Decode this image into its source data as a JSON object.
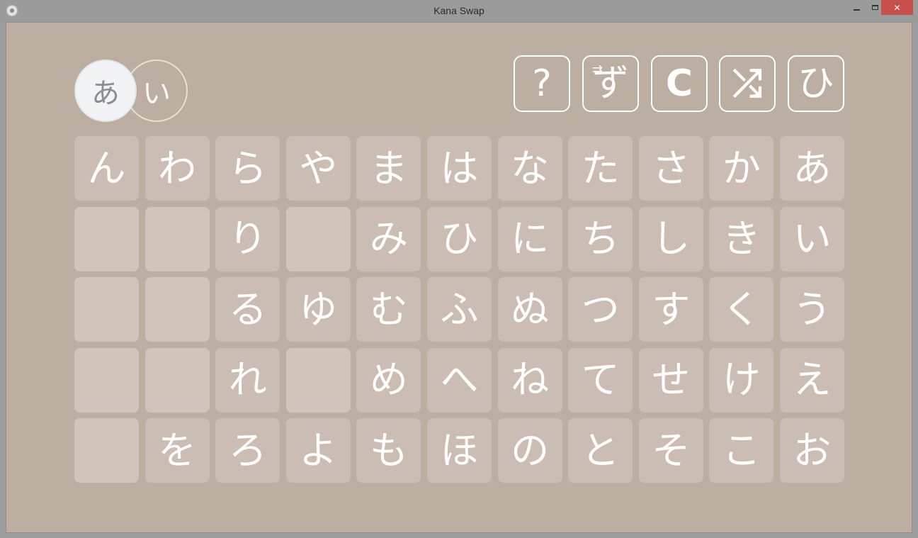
{
  "window": {
    "title": "Kana Swap",
    "close_label": "✕",
    "close_color": "#c7504b"
  },
  "toggle": {
    "active": "あ",
    "inactive": "い"
  },
  "toolbar": {
    "help": "?",
    "swap": "ず",
    "swap_arrows": "⇉",
    "reset": "C",
    "shuffle": "⤮",
    "script": "ひ"
  },
  "grid": {
    "rows": [
      [
        "ん",
        "わ",
        "ら",
        "や",
        "ま",
        "は",
        "な",
        "た",
        "さ",
        "か",
        "あ"
      ],
      [
        "",
        "",
        "り",
        "",
        "み",
        "ひ",
        "に",
        "ち",
        "し",
        "き",
        "い"
      ],
      [
        "",
        "",
        "る",
        "ゆ",
        "む",
        "ふ",
        "ぬ",
        "つ",
        "す",
        "く",
        "う"
      ],
      [
        "",
        "",
        "れ",
        "",
        "め",
        "へ",
        "ね",
        "て",
        "せ",
        "け",
        "え"
      ],
      [
        "",
        "を",
        "ろ",
        "よ",
        "も",
        "ほ",
        "の",
        "と",
        "そ",
        "こ",
        "お"
      ]
    ]
  },
  "colors": {
    "background": "#bcaea1",
    "cell": "#cbbdb3",
    "empty_cell": "#d1c5bb",
    "kana": "#ffffff"
  },
  "icons": [
    "app-icon",
    "minimize-icon",
    "maximize-icon",
    "close-icon",
    "help-icon",
    "swap-icon",
    "reset-icon",
    "shuffle-icon",
    "script-icon"
  ]
}
